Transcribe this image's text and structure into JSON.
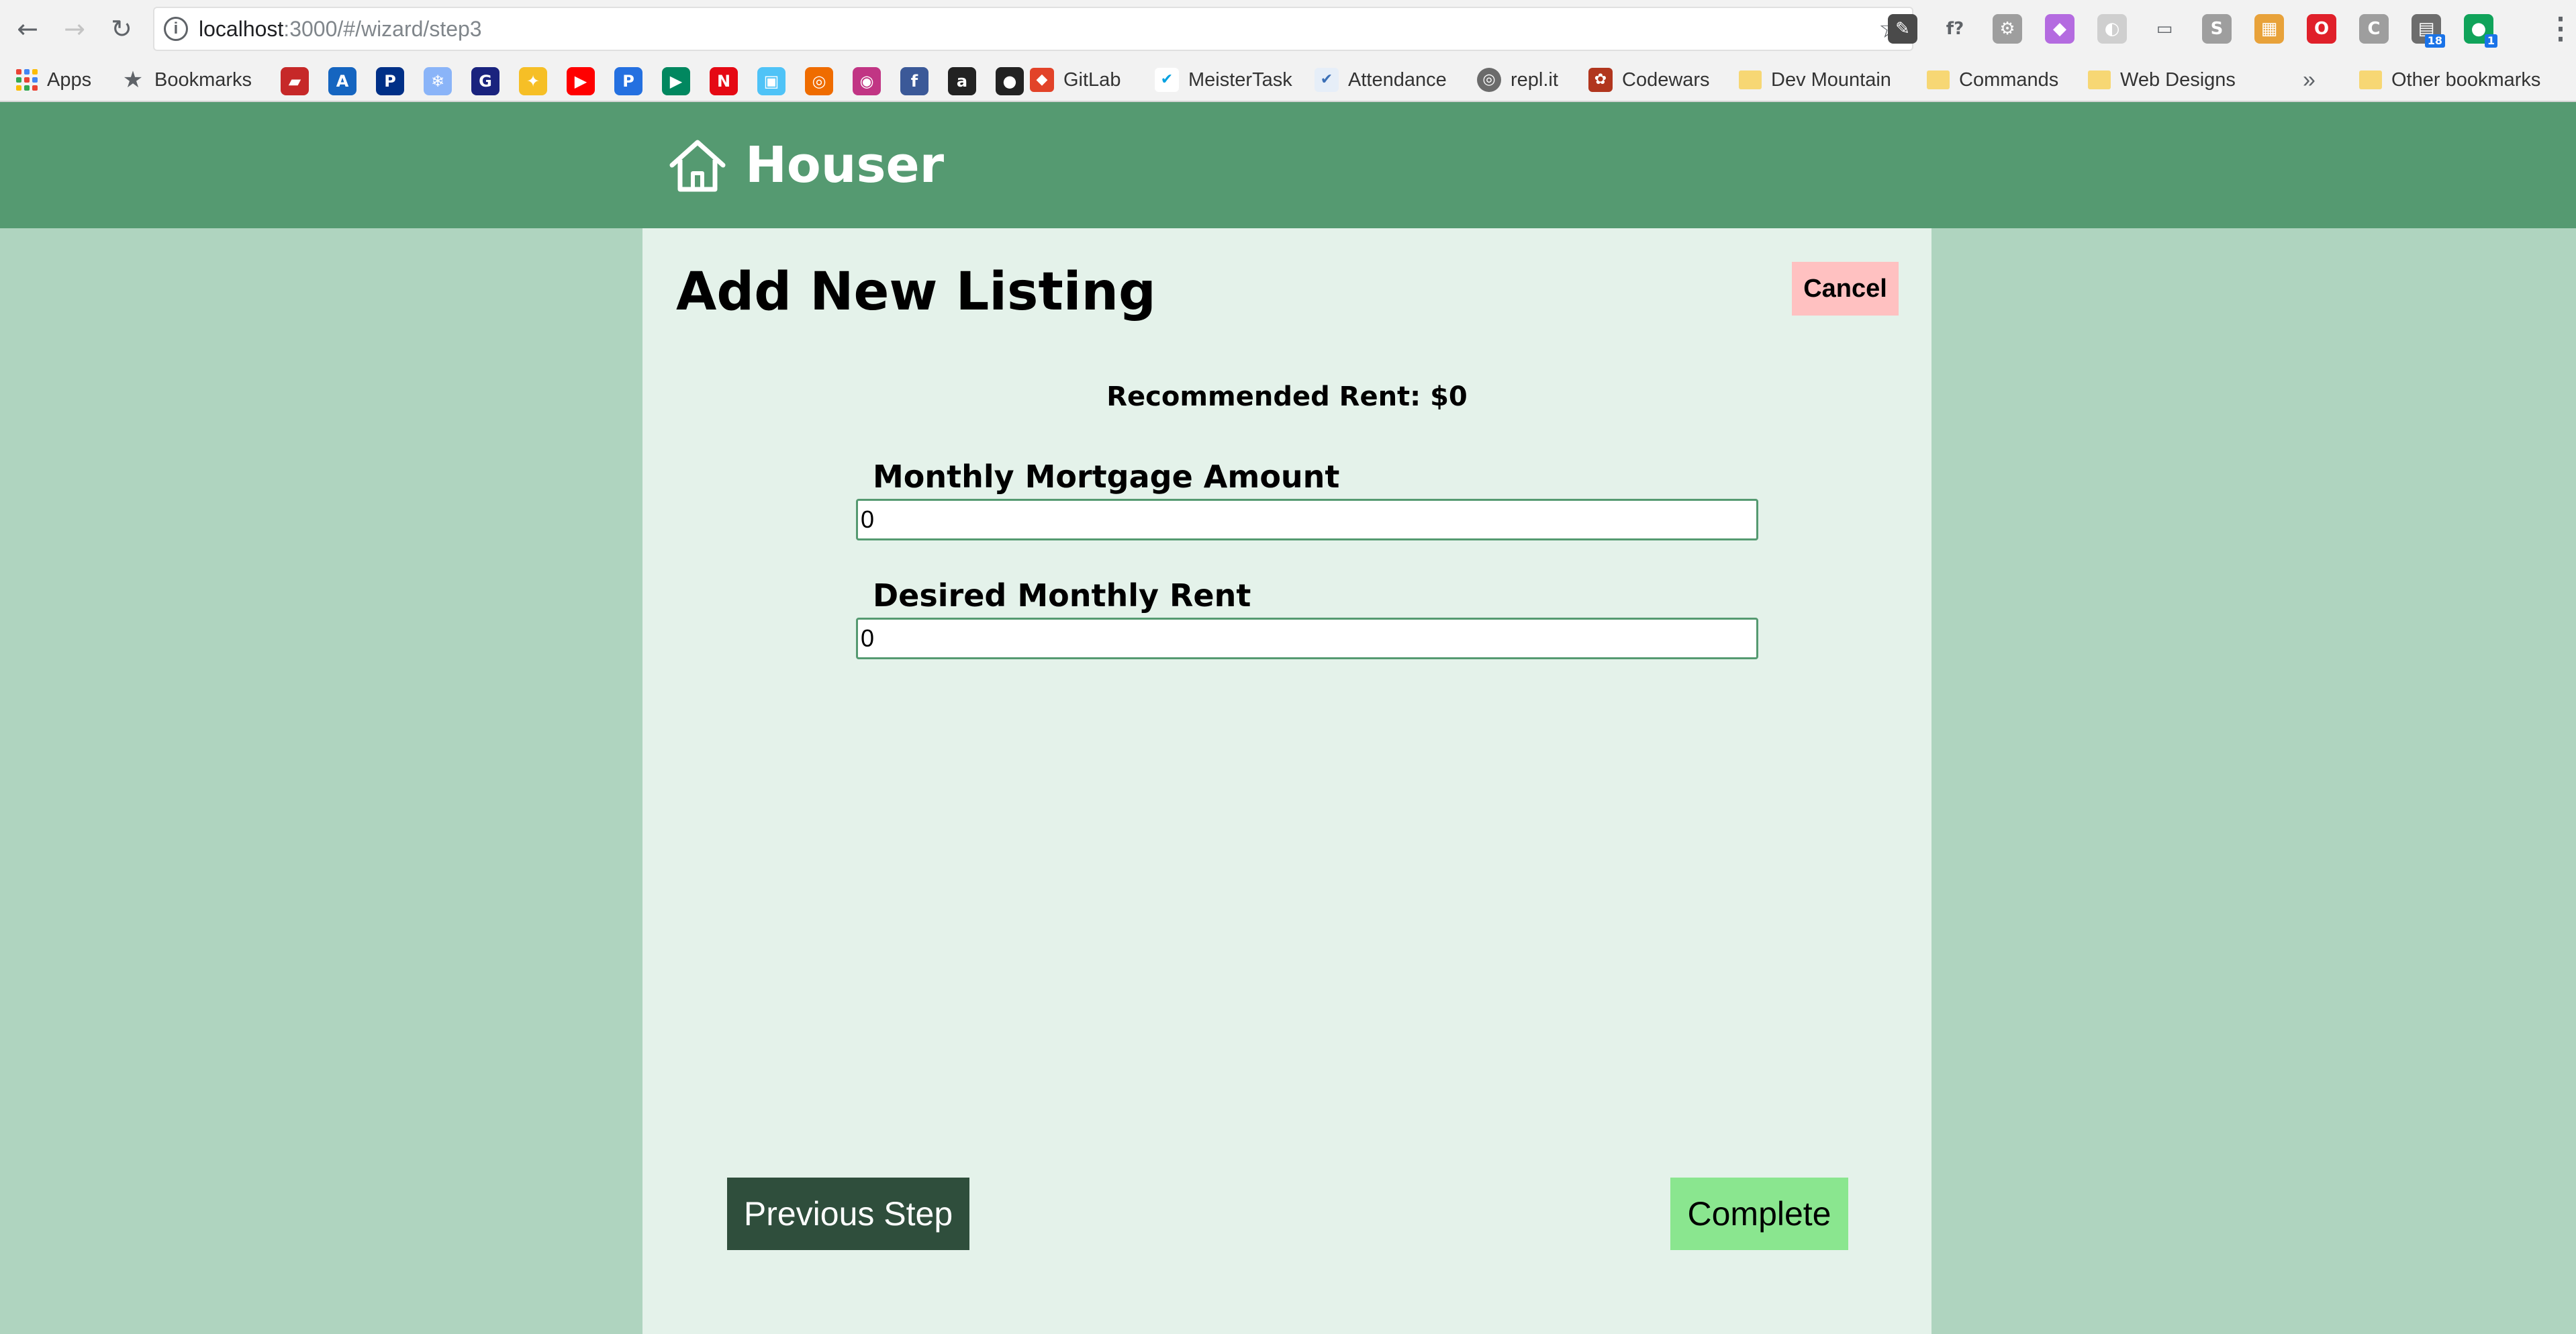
{
  "browser": {
    "url_host": "localhost",
    "url_path": ":3000/#/wizard/step3",
    "extensions": [
      {
        "name": "eyedropper-extension-icon",
        "glyph": "✎",
        "color": "#4a4a4a",
        "badge": ""
      },
      {
        "name": "formula-extension-icon",
        "glyph": "f?",
        "color": "#ffffff",
        "badge": ""
      },
      {
        "name": "gear-extension-icon",
        "glyph": "⚙",
        "color": "#9e9e9e",
        "badge": ""
      },
      {
        "name": "purple-extension-icon",
        "glyph": "◆",
        "color": "#b46be0",
        "badge": ""
      },
      {
        "name": "grey-extension-icon",
        "glyph": "◐",
        "color": "#cfcfcf",
        "badge": ""
      },
      {
        "name": "cast-icon",
        "glyph": "▭",
        "color": "#ffffff",
        "badge": ""
      },
      {
        "name": "s-extension-icon",
        "glyph": "S",
        "color": "#9e9e9e",
        "badge": ""
      },
      {
        "name": "colorful-extension-icon",
        "glyph": "▦",
        "color": "#e8a23a",
        "badge": ""
      },
      {
        "name": "opera-extension-icon",
        "glyph": "O",
        "color": "#e0202a",
        "badge": ""
      },
      {
        "name": "c-extension-icon",
        "glyph": "C",
        "color": "#9e9e9e",
        "badge": ""
      },
      {
        "name": "tabs-extension-icon",
        "glyph": "▤",
        "color": "#6d6d6d",
        "badge": "18"
      },
      {
        "name": "chat-extension-icon",
        "glyph": "●",
        "color": "#10a35a",
        "badge": "1"
      }
    ]
  },
  "bookmarks": {
    "apps": "Apps",
    "bookmarks": "Bookmarks",
    "gitlab": "GitLab",
    "meistertask": "MeisterTask",
    "attendance": "Attendance",
    "replit": "repl.it",
    "codewars": "Codewars",
    "dev_mountain": "Dev Mountain",
    "commands": "Commands",
    "web_designs": "Web Designs",
    "more": "»",
    "other": "Other bookmarks",
    "icons": [
      {
        "name": "red-bookmark-icon",
        "glyph": "▰",
        "color": "#c62828"
      },
      {
        "name": "blue-a-bookmark-icon",
        "glyph": "A",
        "color": "#1565c0"
      },
      {
        "name": "paypal-icon",
        "glyph": "P",
        "color": "#003087"
      },
      {
        "name": "snowflake-icon",
        "glyph": "❄",
        "color": "#8ab4f8"
      },
      {
        "name": "g-bookmark-icon",
        "glyph": "G",
        "color": "#1a237e"
      },
      {
        "name": "keep-icon",
        "glyph": "✦",
        "color": "#f6bf26"
      },
      {
        "name": "youtube-icon",
        "glyph": "▶",
        "color": "#ff0000"
      },
      {
        "name": "pandora-icon",
        "glyph": "P",
        "color": "#2470e0"
      },
      {
        "name": "play-store-icon",
        "glyph": "▶",
        "color": "#01875f"
      },
      {
        "name": "netflix-icon",
        "glyph": "N",
        "color": "#e50914"
      },
      {
        "name": "media-bookmark-icon",
        "glyph": "▣",
        "color": "#4fc3f7"
      },
      {
        "name": "ring-bookmark-icon",
        "glyph": "◎",
        "color": "#ef6c00"
      },
      {
        "name": "instagram-icon",
        "glyph": "◉",
        "color": "#c13584"
      },
      {
        "name": "facebook-icon",
        "glyph": "f",
        "color": "#3b5998"
      },
      {
        "name": "amazon-icon",
        "glyph": "a",
        "color": "#222222"
      },
      {
        "name": "github-icon",
        "glyph": "●",
        "color": "#222222"
      }
    ]
  },
  "app": {
    "brand": "Houser",
    "page_title": "Add New Listing",
    "cancel_label": "Cancel",
    "recommended_rent": "Recommended Rent: $0",
    "mortgage_label": "Monthly Mortgage Amount",
    "mortgage_value": "0",
    "rent_label": "Desired Monthly Rent",
    "rent_value": "0",
    "prev_label": "Previous Step",
    "complete_label": "Complete"
  }
}
